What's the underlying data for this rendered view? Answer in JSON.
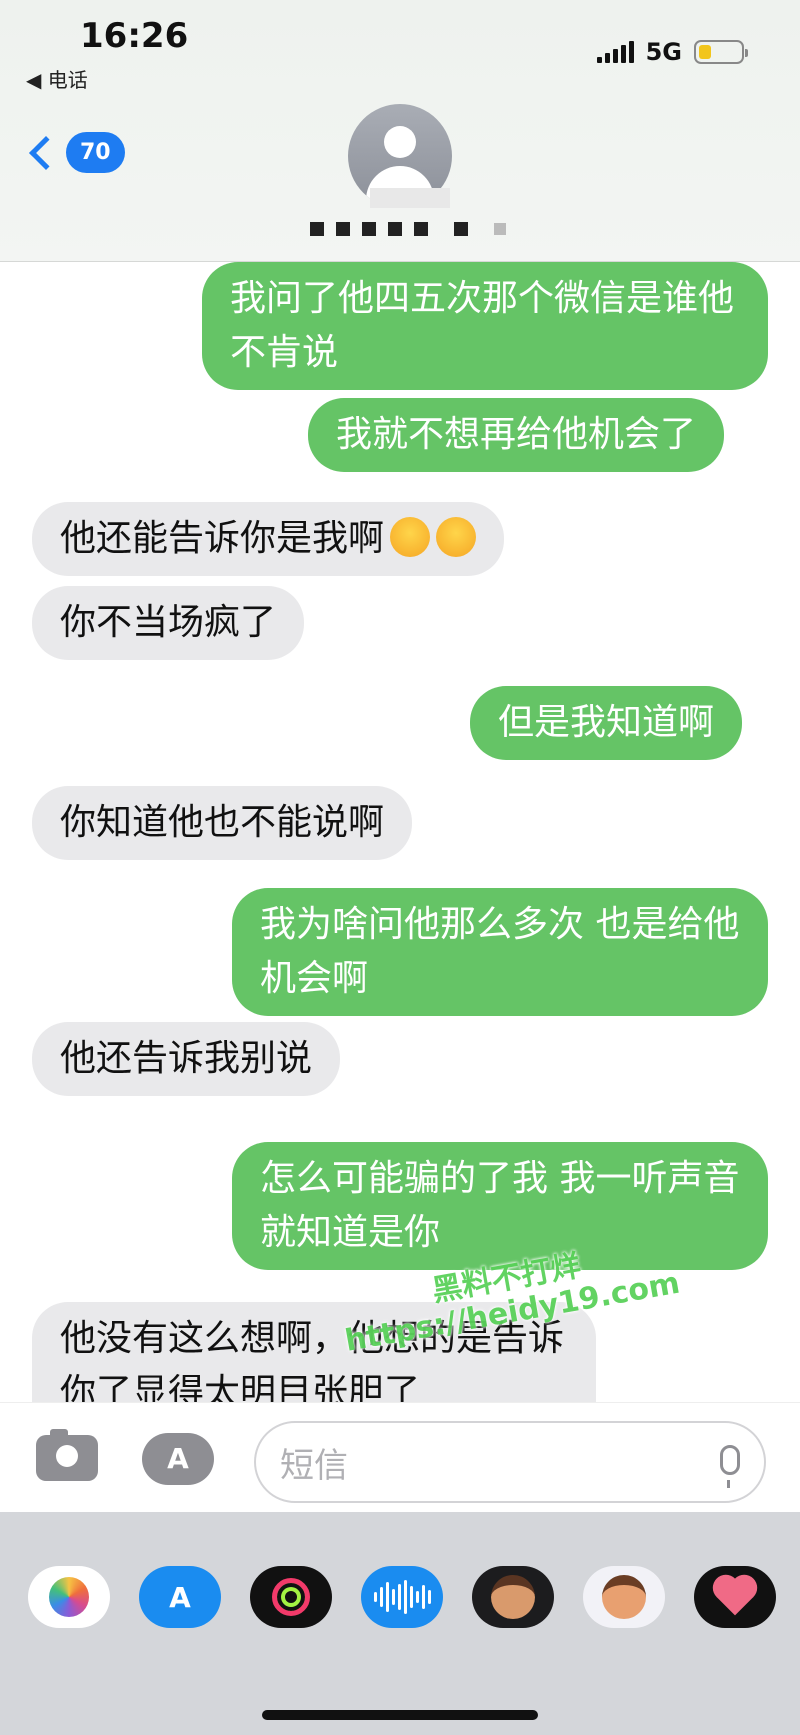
{
  "status_bar": {
    "time": "16:26",
    "back_app": "◀ 电话",
    "network": "5G"
  },
  "header": {
    "unread_count": "70"
  },
  "messages": [
    {
      "direction": "out",
      "text": "我问了他四五次那个微信是谁他不肯说"
    },
    {
      "direction": "out",
      "text": "我就不想再给他机会了"
    },
    {
      "direction": "in",
      "text": "他还能告诉你是我啊",
      "emoji": [
        "upside-down-face",
        "upside-down-face"
      ]
    },
    {
      "direction": "in",
      "text": "你不当场疯了"
    },
    {
      "direction": "out",
      "text": "但是我知道啊"
    },
    {
      "direction": "in",
      "text": "你知道他也不能说啊"
    },
    {
      "direction": "out",
      "text": "我为啥问他那么多次 也是给他机会啊"
    },
    {
      "direction": "in",
      "text": "他还告诉我别说"
    },
    {
      "direction": "out",
      "text": "怎么可能骗的了我 我一听声音就知道是你"
    },
    {
      "direction": "in",
      "text": "他没有这么想啊，他想的是告诉你了显得太明目张胆了"
    }
  ],
  "watermark": {
    "line1": "黑料不打烊",
    "line2": "https://heidy19.com"
  },
  "input": {
    "placeholder": "短信"
  },
  "app_drawer": {
    "apps": [
      "photos-icon",
      "app-store-icon",
      "fitness-icon",
      "audio-message-icon",
      "memoji-icon",
      "memoji-stickers-icon",
      "digital-touch-icon"
    ]
  },
  "colors": {
    "outgoing_bubble": "#65c466",
    "incoming_bubble": "#e9e9eb",
    "accent": "#1e7cf2"
  }
}
